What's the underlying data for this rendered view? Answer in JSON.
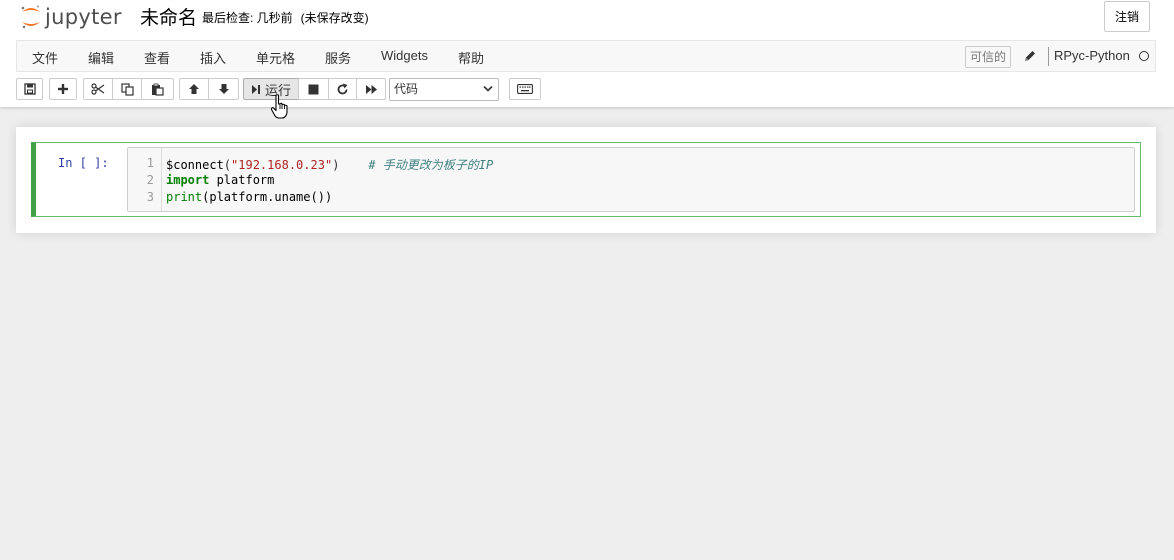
{
  "header": {
    "logo_text": "jupyter",
    "notebook_name": "未命名",
    "checkpoint_label": "最后检查: 几秒前",
    "autosave_status": "(未保存改变)",
    "logout_label": "注销"
  },
  "menubar": {
    "items": [
      "文件",
      "编辑",
      "查看",
      "插入",
      "单元格",
      "服务",
      "Widgets",
      "帮助"
    ],
    "trusted_label": "可信的",
    "kernel_name": "RPyc-Python"
  },
  "toolbar": {
    "run_label": "运行",
    "cell_type_selected": "代码"
  },
  "cell": {
    "prompt": "In [ ]:",
    "line_numbers": [
      "1",
      "2",
      "3"
    ],
    "lines": [
      {
        "fn": "$connect",
        "open": "(",
        "str": "\"192.168.0.23\"",
        "close": ")",
        "comment": "# 手动更改为板子的IP"
      },
      {
        "kw": "import",
        "rest": " platform"
      },
      {
        "fn": "print",
        "rest": "(platform.uname())"
      }
    ]
  },
  "colors": {
    "cell_selected_border": "#42a048",
    "prompt": "#303f9f",
    "keyword": "#008000",
    "string": "#b22222",
    "comment": "#408080"
  }
}
